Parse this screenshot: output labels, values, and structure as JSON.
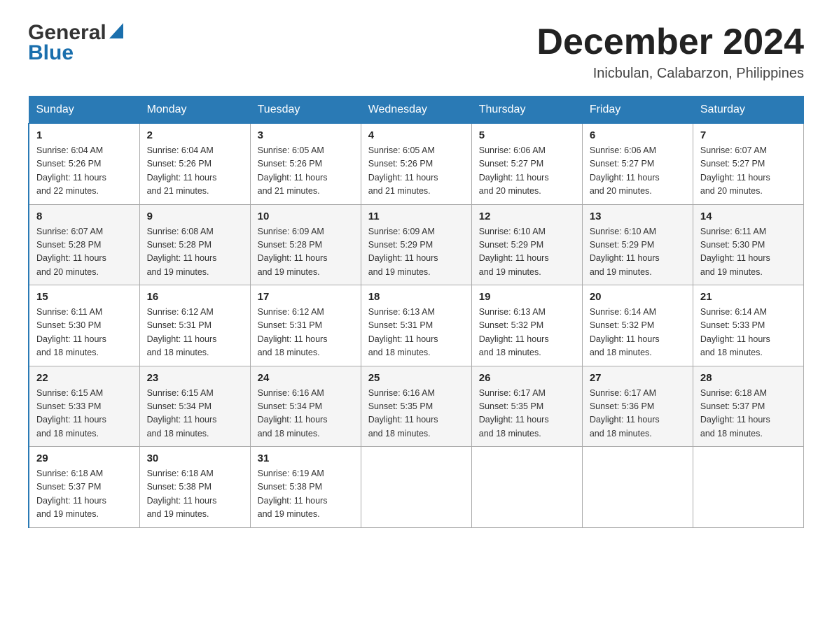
{
  "header": {
    "logo_general": "General",
    "logo_blue": "Blue",
    "month_title": "December 2024",
    "location": "Inicbulan, Calabarzon, Philippines"
  },
  "weekdays": [
    "Sunday",
    "Monday",
    "Tuesday",
    "Wednesday",
    "Thursday",
    "Friday",
    "Saturday"
  ],
  "weeks": [
    [
      {
        "num": "1",
        "sunrise": "6:04 AM",
        "sunset": "5:26 PM",
        "daylight": "11 hours and 22 minutes."
      },
      {
        "num": "2",
        "sunrise": "6:04 AM",
        "sunset": "5:26 PM",
        "daylight": "11 hours and 21 minutes."
      },
      {
        "num": "3",
        "sunrise": "6:05 AM",
        "sunset": "5:26 PM",
        "daylight": "11 hours and 21 minutes."
      },
      {
        "num": "4",
        "sunrise": "6:05 AM",
        "sunset": "5:26 PM",
        "daylight": "11 hours and 21 minutes."
      },
      {
        "num": "5",
        "sunrise": "6:06 AM",
        "sunset": "5:27 PM",
        "daylight": "11 hours and 20 minutes."
      },
      {
        "num": "6",
        "sunrise": "6:06 AM",
        "sunset": "5:27 PM",
        "daylight": "11 hours and 20 minutes."
      },
      {
        "num": "7",
        "sunrise": "6:07 AM",
        "sunset": "5:27 PM",
        "daylight": "11 hours and 20 minutes."
      }
    ],
    [
      {
        "num": "8",
        "sunrise": "6:07 AM",
        "sunset": "5:28 PM",
        "daylight": "11 hours and 20 minutes."
      },
      {
        "num": "9",
        "sunrise": "6:08 AM",
        "sunset": "5:28 PM",
        "daylight": "11 hours and 19 minutes."
      },
      {
        "num": "10",
        "sunrise": "6:09 AM",
        "sunset": "5:28 PM",
        "daylight": "11 hours and 19 minutes."
      },
      {
        "num": "11",
        "sunrise": "6:09 AM",
        "sunset": "5:29 PM",
        "daylight": "11 hours and 19 minutes."
      },
      {
        "num": "12",
        "sunrise": "6:10 AM",
        "sunset": "5:29 PM",
        "daylight": "11 hours and 19 minutes."
      },
      {
        "num": "13",
        "sunrise": "6:10 AM",
        "sunset": "5:29 PM",
        "daylight": "11 hours and 19 minutes."
      },
      {
        "num": "14",
        "sunrise": "6:11 AM",
        "sunset": "5:30 PM",
        "daylight": "11 hours and 19 minutes."
      }
    ],
    [
      {
        "num": "15",
        "sunrise": "6:11 AM",
        "sunset": "5:30 PM",
        "daylight": "11 hours and 18 minutes."
      },
      {
        "num": "16",
        "sunrise": "6:12 AM",
        "sunset": "5:31 PM",
        "daylight": "11 hours and 18 minutes."
      },
      {
        "num": "17",
        "sunrise": "6:12 AM",
        "sunset": "5:31 PM",
        "daylight": "11 hours and 18 minutes."
      },
      {
        "num": "18",
        "sunrise": "6:13 AM",
        "sunset": "5:31 PM",
        "daylight": "11 hours and 18 minutes."
      },
      {
        "num": "19",
        "sunrise": "6:13 AM",
        "sunset": "5:32 PM",
        "daylight": "11 hours and 18 minutes."
      },
      {
        "num": "20",
        "sunrise": "6:14 AM",
        "sunset": "5:32 PM",
        "daylight": "11 hours and 18 minutes."
      },
      {
        "num": "21",
        "sunrise": "6:14 AM",
        "sunset": "5:33 PM",
        "daylight": "11 hours and 18 minutes."
      }
    ],
    [
      {
        "num": "22",
        "sunrise": "6:15 AM",
        "sunset": "5:33 PM",
        "daylight": "11 hours and 18 minutes."
      },
      {
        "num": "23",
        "sunrise": "6:15 AM",
        "sunset": "5:34 PM",
        "daylight": "11 hours and 18 minutes."
      },
      {
        "num": "24",
        "sunrise": "6:16 AM",
        "sunset": "5:34 PM",
        "daylight": "11 hours and 18 minutes."
      },
      {
        "num": "25",
        "sunrise": "6:16 AM",
        "sunset": "5:35 PM",
        "daylight": "11 hours and 18 minutes."
      },
      {
        "num": "26",
        "sunrise": "6:17 AM",
        "sunset": "5:35 PM",
        "daylight": "11 hours and 18 minutes."
      },
      {
        "num": "27",
        "sunrise": "6:17 AM",
        "sunset": "5:36 PM",
        "daylight": "11 hours and 18 minutes."
      },
      {
        "num": "28",
        "sunrise": "6:18 AM",
        "sunset": "5:37 PM",
        "daylight": "11 hours and 18 minutes."
      }
    ],
    [
      {
        "num": "29",
        "sunrise": "6:18 AM",
        "sunset": "5:37 PM",
        "daylight": "11 hours and 19 minutes."
      },
      {
        "num": "30",
        "sunrise": "6:18 AM",
        "sunset": "5:38 PM",
        "daylight": "11 hours and 19 minutes."
      },
      {
        "num": "31",
        "sunrise": "6:19 AM",
        "sunset": "5:38 PM",
        "daylight": "11 hours and 19 minutes."
      },
      null,
      null,
      null,
      null
    ]
  ],
  "labels": {
    "sunrise": "Sunrise:",
    "sunset": "Sunset:",
    "daylight": "Daylight:"
  }
}
